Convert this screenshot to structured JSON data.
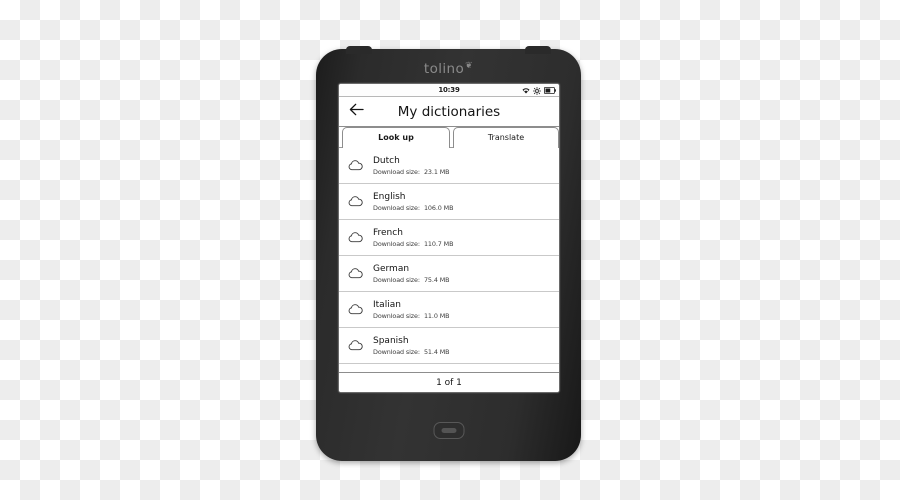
{
  "device": {
    "brand": "tolino",
    "brand_mark": "❦",
    "home_button_label": "home-button"
  },
  "status_bar": {
    "time": "10:39",
    "icons": [
      "wifi-icon",
      "brightness-icon",
      "battery-icon"
    ]
  },
  "header": {
    "back_icon": "back-arrow-icon",
    "title": "My dictionaries"
  },
  "tabs": [
    {
      "label": "Look up",
      "active": true
    },
    {
      "label": "Translate",
      "active": false
    }
  ],
  "list": {
    "size_label": "Download size:",
    "items": [
      {
        "name": "Dutch",
        "size": "23.1 MB",
        "icon": "cloud-download-icon"
      },
      {
        "name": "English",
        "size": "106.0 MB",
        "icon": "cloud-download-icon"
      },
      {
        "name": "French",
        "size": "110.7 MB",
        "icon": "cloud-download-icon"
      },
      {
        "name": "German",
        "size": "75.4 MB",
        "icon": "cloud-download-icon"
      },
      {
        "name": "Italian",
        "size": "11.0 MB",
        "icon": "cloud-download-icon"
      },
      {
        "name": "Spanish",
        "size": "51.4 MB",
        "icon": "cloud-download-icon"
      }
    ]
  },
  "pager": {
    "label": "1 of 1"
  },
  "colors": {
    "device_body": "#2d2d2d",
    "screen_bg": "#ffffff",
    "text": "#141414",
    "divider": "#c9c9c9"
  }
}
